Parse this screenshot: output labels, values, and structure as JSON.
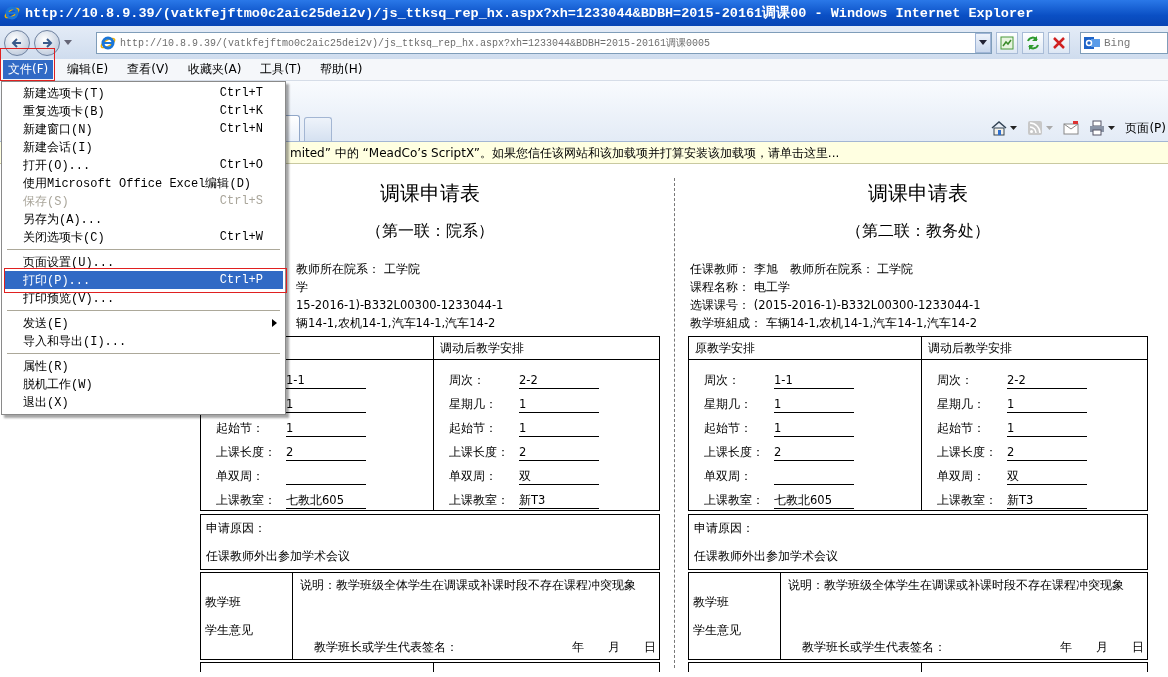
{
  "window": {
    "title": "http://10.8.9.39/(vatkfejftmo0c2aic25dei2v)/js_ttksq_rep_hx.aspx?xh=1233044&BDBH=2015-20161调课00 - Windows Internet Explorer"
  },
  "address_bar": {
    "url": "http://10.8.9.39/(vatkfejftmo0c2aic25dei2v)/js_ttksq_rep_hx.aspx?xh=1233044&BDBH=2015-20161调课0005",
    "search_placeholder": "Bing"
  },
  "menu_bar": [
    {
      "label": "文件(F)",
      "selected": true
    },
    {
      "label": "编辑(E)",
      "selected": false
    },
    {
      "label": "查看(V)",
      "selected": false
    },
    {
      "label": "收藏夹(A)",
      "selected": false
    },
    {
      "label": "工具(T)",
      "selected": false
    },
    {
      "label": "帮助(H)",
      "selected": false
    }
  ],
  "command_bar": {
    "page_menu": "页面(P)"
  },
  "info_bar": {
    "text": "mited” 中的 “MeadCo’s ScriptX”。如果您信任该网站和该加载项并打算安装该加载项，请单击这里..."
  },
  "file_menu": [
    {
      "kind": "item",
      "label": "新建选项卡(T)",
      "shortcut": "Ctrl+T",
      "disabled": false,
      "selected": false
    },
    {
      "kind": "item",
      "label": "重复选项卡(B)",
      "shortcut": "Ctrl+K",
      "disabled": false,
      "selected": false
    },
    {
      "kind": "item",
      "label": "新建窗口(N)",
      "shortcut": "Ctrl+N",
      "disabled": false,
      "selected": false
    },
    {
      "kind": "item",
      "label": "新建会话(I)",
      "disabled": false,
      "selected": false
    },
    {
      "kind": "item",
      "label": "打开(O)...",
      "shortcut": "Ctrl+O",
      "disabled": false,
      "selected": false
    },
    {
      "kind": "item",
      "label": "使用Microsoft Office Excel编辑(D)",
      "disabled": false,
      "selected": false
    },
    {
      "kind": "item",
      "label": "保存(S)",
      "shortcut": "Ctrl+S",
      "disabled": true,
      "selected": false
    },
    {
      "kind": "item",
      "label": "另存为(A)...",
      "disabled": false,
      "selected": false
    },
    {
      "kind": "item",
      "label": "关闭选项卡(C)",
      "shortcut": "Ctrl+W",
      "disabled": false,
      "selected": false
    },
    {
      "kind": "separator"
    },
    {
      "kind": "item",
      "label": "页面设置(U)...",
      "disabled": false,
      "selected": false
    },
    {
      "kind": "item",
      "label": "打印(P)...",
      "shortcut": "Ctrl+P",
      "disabled": false,
      "selected": true
    },
    {
      "kind": "item",
      "label": "打印预览(V)...",
      "disabled": false,
      "selected": false
    },
    {
      "kind": "separator"
    },
    {
      "kind": "submenu",
      "label": "发送(E)",
      "disabled": false,
      "selected": false
    },
    {
      "kind": "item",
      "label": "导入和导出(I)...",
      "disabled": false,
      "selected": false
    },
    {
      "kind": "separator"
    },
    {
      "kind": "item",
      "label": "属性(R)",
      "disabled": false,
      "selected": false
    },
    {
      "kind": "item",
      "label": "脱机工作(W)",
      "disabled": false,
      "selected": false
    },
    {
      "kind": "item",
      "label": "退出(X)",
      "disabled": false,
      "selected": false
    }
  ],
  "forms": [
    {
      "title": "调课申请表",
      "subtitle": "（第一联：院系）",
      "covered": true,
      "info": [
        "教师所在院系： 工学院",
        "学",
        "15-2016-1)-B332L00300-1233044-1",
        "辆14-1,农机14-1,汽车14-1,汽车14-2"
      ],
      "schedule": [
        {
          "rows": [
            {
              "value": "1-1"
            },
            {
              "value": "1"
            },
            {
              "label": "起始节：",
              "value": "1"
            },
            {
              "label": "上课长度：",
              "value": "2"
            },
            {
              "label": "单双周："
            },
            {
              "label": "上课教室：",
              "value": "七教北605"
            }
          ]
        },
        {
          "header": "调动后教学安排",
          "rows": [
            {
              "label": "周次：",
              "value": "2-2"
            },
            {
              "label": "星期几：",
              "value": "1"
            },
            {
              "label": "起始节：",
              "value": "1"
            },
            {
              "label": "上课长度：",
              "value": "2"
            },
            {
              "label": "单双周：",
              "value": "双"
            },
            {
              "label": "上课教室：",
              "value": "新T3"
            }
          ]
        }
      ],
      "reason": {
        "label": "申请原因：",
        "text": "任课教师外出参加学术会议"
      },
      "student_opinion": {
        "label_lines": [
          "教学班",
          "学生意见"
        ],
        "note": "说明：教学班级全体学生在调课或补课时段不存在课程冲突现象",
        "signature": "教学班长或学生代表签名：",
        "date": [
          "年",
          "月",
          "日"
        ]
      }
    },
    {
      "title": "调课申请表",
      "subtitle": "（第二联：教务处）",
      "covered": false,
      "info": [
        "任课教师： 李旭　教师所在院系： 工学院",
        "课程名称： 电工学",
        "选课课号： (2015-2016-1)-B332L00300-1233044-1",
        "教学班組成： 车辆14-1,农机14-1,汽车14-1,汽车14-2"
      ],
      "schedule": [
        {
          "header": "原教学安排",
          "rows": [
            {
              "label": "周次：",
              "value": "1-1"
            },
            {
              "label": "星期几：",
              "value": "1"
            },
            {
              "label": "起始节：",
              "value": "1"
            },
            {
              "label": "上课长度：",
              "value": "2"
            },
            {
              "label": "单双周："
            },
            {
              "label": "上课教室：",
              "value": "七教北605"
            }
          ]
        },
        {
          "header": "调动后教学安排",
          "rows": [
            {
              "label": "周次：",
              "value": "2-2"
            },
            {
              "label": "星期几：",
              "value": "1"
            },
            {
              "label": "起始节：",
              "value": "1"
            },
            {
              "label": "上课长度：",
              "value": "2"
            },
            {
              "label": "单双周：",
              "value": "双"
            },
            {
              "label": "上课教室：",
              "value": "新T3"
            }
          ]
        }
      ],
      "reason": {
        "label": "申请原因：",
        "text": "任课教师外出参加学术会议"
      },
      "student_opinion": {
        "label_lines": [
          "教学班",
          "学生意见"
        ],
        "note": "说明：教学班级全体学生在调课或补课时段不存在课程冲突现象",
        "signature": "教学班长或学生代表签名：",
        "date": [
          "年",
          "月",
          "日"
        ]
      }
    }
  ]
}
